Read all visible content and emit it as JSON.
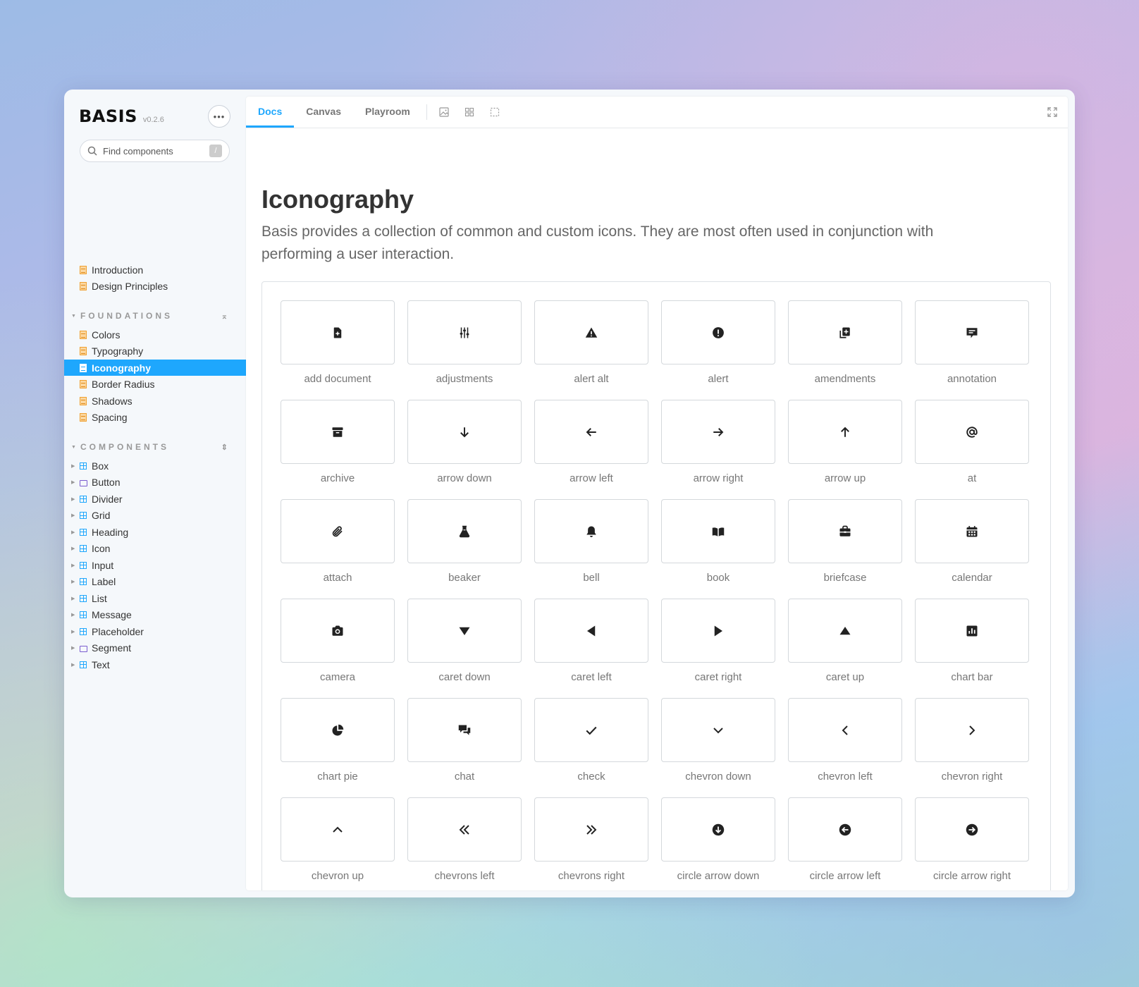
{
  "app": {
    "name": "BASIS",
    "version": "v0.2.6"
  },
  "search": {
    "placeholder": "Find components",
    "shortcut": "/"
  },
  "top_docs": [
    {
      "label": "Introduction"
    },
    {
      "label": "Design Principles"
    }
  ],
  "foundations": {
    "title": "FOUNDATIONS",
    "items": [
      {
        "label": "Colors"
      },
      {
        "label": "Typography"
      },
      {
        "label": "Iconography",
        "active": true
      },
      {
        "label": "Border Radius"
      },
      {
        "label": "Shadows"
      },
      {
        "label": "Spacing"
      }
    ]
  },
  "components": {
    "title": "COMPONENTS",
    "items": [
      {
        "label": "Box",
        "icon": "grid-icon"
      },
      {
        "label": "Button",
        "icon": "folder-icon"
      },
      {
        "label": "Divider",
        "icon": "grid-icon"
      },
      {
        "label": "Grid",
        "icon": "grid-icon"
      },
      {
        "label": "Heading",
        "icon": "grid-icon"
      },
      {
        "label": "Icon",
        "icon": "grid-icon"
      },
      {
        "label": "Input",
        "icon": "grid-icon"
      },
      {
        "label": "Label",
        "icon": "grid-icon"
      },
      {
        "label": "List",
        "icon": "grid-icon"
      },
      {
        "label": "Message",
        "icon": "grid-icon"
      },
      {
        "label": "Placeholder",
        "icon": "grid-icon"
      },
      {
        "label": "Segment",
        "icon": "folder-icon"
      },
      {
        "label": "Text",
        "icon": "grid-icon"
      }
    ]
  },
  "toolbar": {
    "tabs": [
      {
        "label": "Docs",
        "active": true
      },
      {
        "label": "Canvas"
      },
      {
        "label": "Playroom"
      }
    ],
    "tools": [
      "image-icon",
      "grid-view-icon",
      "outline-icon"
    ],
    "fullscreen_icon": "fullscreen-icon"
  },
  "page": {
    "title": "Iconography",
    "description": "Basis provides a collection of common and custom icons. They are most often used in conjunction with performing a user interaction."
  },
  "icons": [
    {
      "label": "add document",
      "icon": "add-document"
    },
    {
      "label": "adjustments",
      "icon": "adjustments"
    },
    {
      "label": "alert alt",
      "icon": "alert-alt"
    },
    {
      "label": "alert",
      "icon": "alert"
    },
    {
      "label": "amendments",
      "icon": "amendments"
    },
    {
      "label": "annotation",
      "icon": "annotation"
    },
    {
      "label": "archive",
      "icon": "archive"
    },
    {
      "label": "arrow down",
      "icon": "arrow-down"
    },
    {
      "label": "arrow left",
      "icon": "arrow-left"
    },
    {
      "label": "arrow right",
      "icon": "arrow-right"
    },
    {
      "label": "arrow up",
      "icon": "arrow-up"
    },
    {
      "label": "at",
      "icon": "at"
    },
    {
      "label": "attach",
      "icon": "attach"
    },
    {
      "label": "beaker",
      "icon": "beaker"
    },
    {
      "label": "bell",
      "icon": "bell"
    },
    {
      "label": "book",
      "icon": "book"
    },
    {
      "label": "briefcase",
      "icon": "briefcase"
    },
    {
      "label": "calendar",
      "icon": "calendar"
    },
    {
      "label": "camera",
      "icon": "camera"
    },
    {
      "label": "caret down",
      "icon": "caret-down"
    },
    {
      "label": "caret left",
      "icon": "caret-left"
    },
    {
      "label": "caret right",
      "icon": "caret-right"
    },
    {
      "label": "caret up",
      "icon": "caret-up"
    },
    {
      "label": "chart bar",
      "icon": "chart-bar"
    },
    {
      "label": "chart pie",
      "icon": "chart-pie"
    },
    {
      "label": "chat",
      "icon": "chat"
    },
    {
      "label": "check",
      "icon": "check"
    },
    {
      "label": "chevron down",
      "icon": "chevron-down"
    },
    {
      "label": "chevron left",
      "icon": "chevron-left"
    },
    {
      "label": "chevron right",
      "icon": "chevron-right"
    },
    {
      "label": "chevron up",
      "icon": "chevron-up"
    },
    {
      "label": "chevrons left",
      "icon": "chevrons-left"
    },
    {
      "label": "chevrons right",
      "icon": "chevrons-right"
    },
    {
      "label": "circle arrow down",
      "icon": "circle-arrow-down"
    },
    {
      "label": "circle arrow left",
      "icon": "circle-arrow-left"
    },
    {
      "label": "circle arrow right",
      "icon": "circle-arrow-right"
    }
  ],
  "colors": {
    "accent": "#1ea7fd",
    "icon": "#222222",
    "doc_icon": "#f0a030"
  }
}
